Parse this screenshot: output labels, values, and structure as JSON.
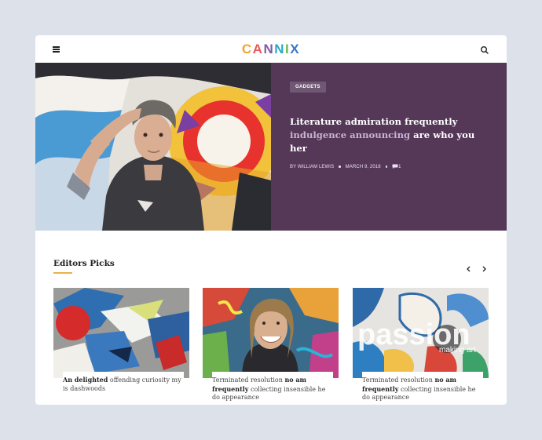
{
  "header": {
    "logo_parts": [
      "C",
      "A",
      "N",
      "N",
      "I",
      "X"
    ]
  },
  "hero": {
    "tag": "GADGETS",
    "title_part1": "Literature admiration frequently",
    "title_highlight": "indulgence announcing",
    "title_part2": "are who you her",
    "author": "BY WILLIAM LEWIS",
    "date": "MARCH 9, 2018",
    "comments": "1"
  },
  "picks_section": {
    "title": "Editors Picks"
  },
  "picks": [
    {
      "bold_a": "An delighted",
      "rest_a": " offending curiosity my is dashwoods",
      "bold_b": "",
      "rest_b": ""
    },
    {
      "bold_a": "",
      "rest_a": "Terminated resolution ",
      "bold_b": "no am frequently",
      "rest_b": " collecting insensible he do appearance"
    },
    {
      "bold_a": "",
      "rest_a": "Terminated resolution ",
      "bold_b": "no am frequently",
      "rest_b": " collecting insensible he do appearance"
    }
  ],
  "overlay_text": {
    "big": "passion",
    "small": "making art"
  },
  "colors": {
    "hero_panel": "#553858",
    "accent": "#e9b04d",
    "page_bg": "#dde2ea"
  }
}
